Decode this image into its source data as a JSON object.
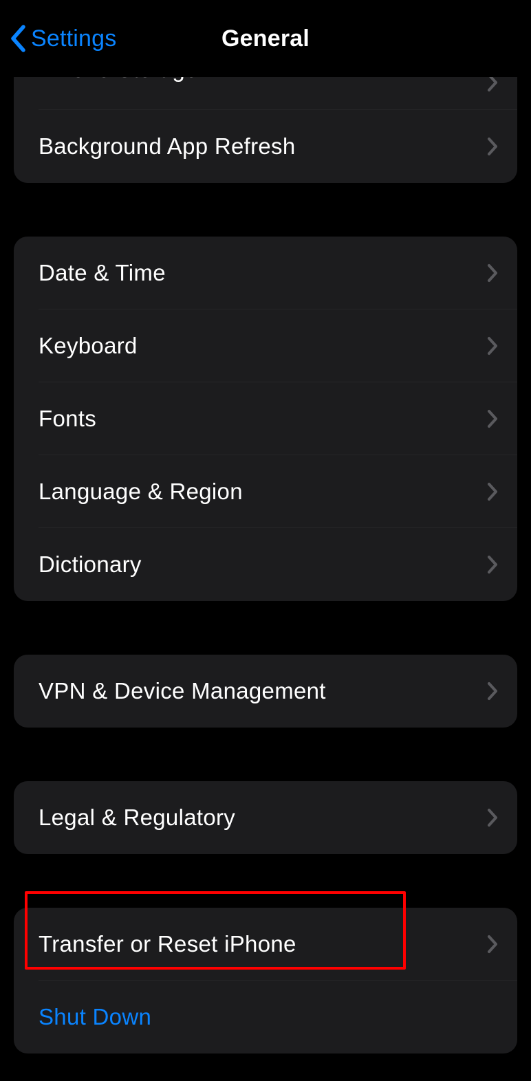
{
  "nav": {
    "back_label": "Settings",
    "title": "General"
  },
  "groups": [
    {
      "id": "storage",
      "rows": [
        {
          "id": "iphone-storage",
          "label": "iPhone Storage",
          "disclosure": true,
          "clipped": true
        },
        {
          "id": "background-app-refresh",
          "label": "Background App Refresh",
          "disclosure": true
        }
      ]
    },
    {
      "id": "datetime",
      "rows": [
        {
          "id": "date-time",
          "label": "Date & Time",
          "disclosure": true
        },
        {
          "id": "keyboard",
          "label": "Keyboard",
          "disclosure": true
        },
        {
          "id": "fonts",
          "label": "Fonts",
          "disclosure": true
        },
        {
          "id": "language-region",
          "label": "Language & Region",
          "disclosure": true
        },
        {
          "id": "dictionary",
          "label": "Dictionary",
          "disclosure": true
        }
      ]
    },
    {
      "id": "vpn",
      "rows": [
        {
          "id": "vpn-device-management",
          "label": "VPN & Device Management",
          "disclosure": true
        }
      ]
    },
    {
      "id": "legal",
      "rows": [
        {
          "id": "legal-regulatory",
          "label": "Legal & Regulatory",
          "disclosure": true
        }
      ]
    },
    {
      "id": "reset",
      "rows": [
        {
          "id": "transfer-reset",
          "label": "Transfer or Reset iPhone",
          "disclosure": true,
          "highlighted": true
        },
        {
          "id": "shut-down",
          "label": "Shut Down",
          "disclosure": false,
          "blue": true
        }
      ]
    }
  ]
}
